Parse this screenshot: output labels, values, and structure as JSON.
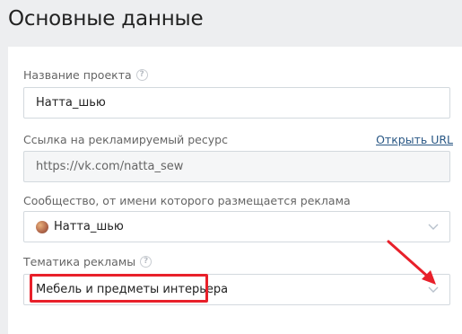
{
  "page": {
    "title": "Основные данные"
  },
  "form": {
    "project_name": {
      "label": "Название проекта",
      "value": "Натта_шью"
    },
    "url": {
      "label": "Ссылка на рекламируемый ресурс",
      "value": "https://vk.com/natta_sew",
      "open_link": "Открыть URL"
    },
    "community": {
      "label": "Сообщество, от имени которого размещается реклама",
      "value": "Натта_шью"
    },
    "topic": {
      "label": "Тематика рекламы",
      "value": "Мебель и предметы интерьера"
    }
  },
  "icons": {
    "help": "help-circle-icon",
    "dropdown": "chevron-down-icon",
    "avatar": "community-avatar",
    "annotation_arrow": "red-arrow",
    "annotation_box": "red-highlight-box"
  },
  "colors": {
    "link": "#2a5885",
    "annotation": "#e8202a",
    "background": "#edeef0"
  }
}
